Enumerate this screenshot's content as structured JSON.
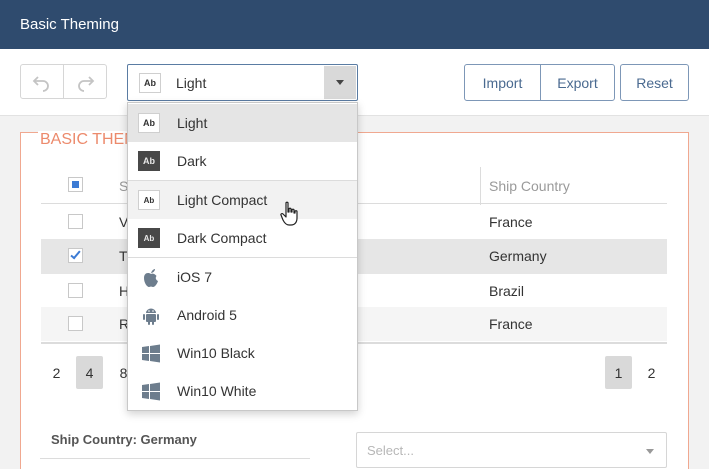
{
  "header": {
    "title": "Basic Theming"
  },
  "toolbar": {
    "undo_icon": "undo-arrow-icon",
    "redo_icon": "redo-arrow-icon",
    "theme_select": {
      "value": "Light",
      "swatch": "Ab"
    },
    "import_label": "Import",
    "export_label": "Export",
    "reset_label": "Reset"
  },
  "panel": {
    "legend": "BASIC THEM"
  },
  "grid": {
    "columns": [
      "S",
      "Ship Country"
    ],
    "header_checkbox_state": "indeterminate",
    "rows": [
      {
        "checked": false,
        "first": "V",
        "country": "France"
      },
      {
        "checked": true,
        "first": "T",
        "country": "Germany"
      },
      {
        "checked": false,
        "first": "H",
        "country": "Brazil"
      },
      {
        "checked": false,
        "first": "R",
        "country": "France"
      }
    ]
  },
  "pager": {
    "left_items": [
      "2",
      "4",
      "8"
    ],
    "left_active": "4",
    "right_items": [
      "1",
      "2"
    ],
    "right_active": "1"
  },
  "group": {
    "label": "Ship Country: Germany",
    "select_placeholder": "Select..."
  },
  "dropdown": {
    "items": [
      {
        "label": "Light",
        "kind": "swatch-light",
        "swatch": "Ab",
        "state": "selected"
      },
      {
        "label": "Dark",
        "kind": "swatch-dark",
        "swatch": "Ab",
        "state": ""
      },
      {
        "label": "Light Compact",
        "kind": "swatch-light-compact",
        "swatch": "Ab",
        "state": "hover"
      },
      {
        "label": "Dark Compact",
        "kind": "swatch-dark-compact",
        "swatch": "Ab",
        "state": ""
      },
      {
        "label": "iOS 7",
        "kind": "apple-icon",
        "state": ""
      },
      {
        "label": "Android 5",
        "kind": "android-icon",
        "state": ""
      },
      {
        "label": "Win10 Black",
        "kind": "windows-icon",
        "state": ""
      },
      {
        "label": "Win10 White",
        "kind": "windows-icon",
        "state": ""
      }
    ]
  },
  "colors": {
    "header_bg": "#2f4b6e",
    "accent_blue": "#3c7bd4",
    "legend_orange": "#ec8a6c",
    "button_text": "#4a6a90"
  }
}
